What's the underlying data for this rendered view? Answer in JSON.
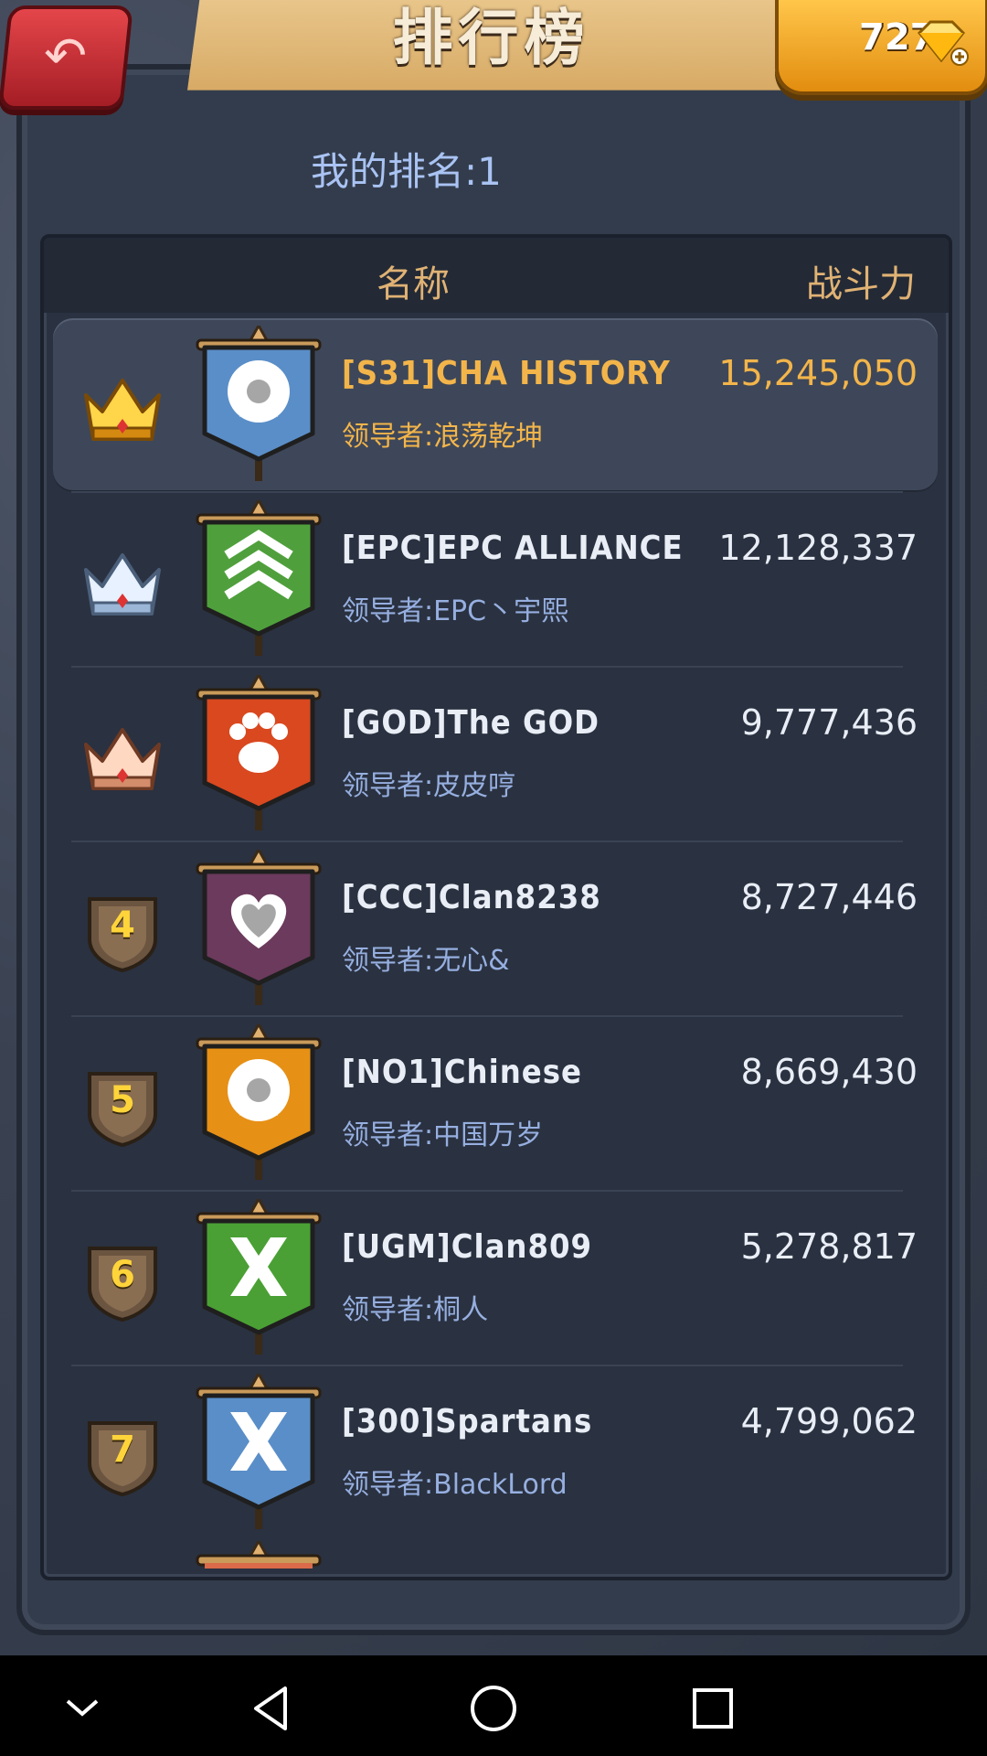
{
  "header": {
    "title": "排行榜",
    "back_icon": "back-arrow-icon",
    "gems": "727",
    "gem_icon": "gem-plus-icon"
  },
  "my_rank": "我的排名:1",
  "table": {
    "col_name": "名称",
    "col_power": "战斗力"
  },
  "rows": [
    {
      "rank": "1",
      "badge": "gold-crown",
      "flag_color": "#5a8ec8",
      "emblem": "star",
      "name": "[S31]CHA HISTORY",
      "leader": "领导者:浪荡乾坤",
      "power": "15,245,050",
      "selected": true
    },
    {
      "rank": "2",
      "badge": "silver-crown",
      "flag_color": "#4fa03c",
      "emblem": "chevrons",
      "name": "[EPC]EPC ALLIANCE",
      "leader": "领导者:EPC丶宇熙",
      "power": "12,128,337"
    },
    {
      "rank": "3",
      "badge": "bronze-crown",
      "flag_color": "#d9481f",
      "emblem": "paw",
      "name": "[GOD]The GOD",
      "leader": "领导者:皮皮哼",
      "power": "9,777,436"
    },
    {
      "rank": "4",
      "badge": "shield",
      "flag_color": "#6b3a5c",
      "emblem": "heart",
      "name": "[CCC]Clan8238",
      "leader": "领导者:无心&",
      "power": "8,727,446"
    },
    {
      "rank": "5",
      "badge": "shield",
      "flag_color": "#e69016",
      "emblem": "star",
      "name": "[NO1]Chinese",
      "leader": "领导者:中国万岁",
      "power": "8,669,430"
    },
    {
      "rank": "6",
      "badge": "shield",
      "flag_color": "#4aa034",
      "emblem": "x",
      "name": "[UGM]Clan809",
      "leader": "领导者:桐人",
      "power": "5,278,817"
    },
    {
      "rank": "7",
      "badge": "shield",
      "flag_color": "#5a8ec8",
      "emblem": "x",
      "name": "[300]Spartans",
      "leader": "领导者:BlackLord",
      "power": "4,799,062"
    }
  ],
  "nav": {
    "collapse_icon": "chevron-down-icon",
    "back_icon": "triangle-back-icon",
    "home_icon": "circle-home-icon",
    "recents_icon": "square-recents-icon"
  }
}
